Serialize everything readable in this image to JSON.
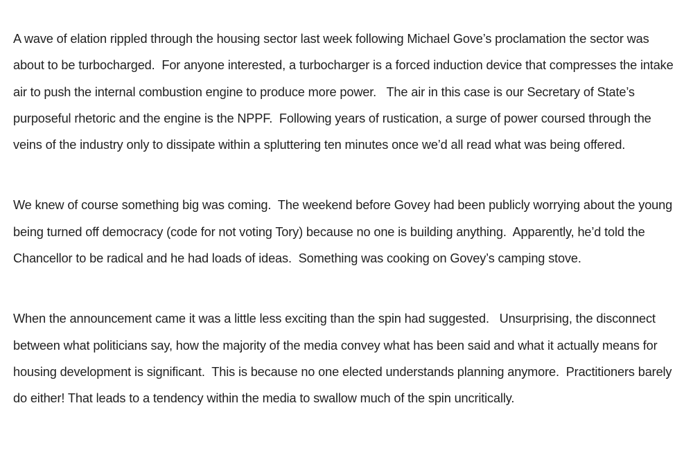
{
  "article": {
    "paragraphs": [
      "A wave of elation rippled through the housing sector last week following Michael Gove’s proclamation the sector was about to be turbocharged.  For anyone interested, a turbocharger is a forced induction device that compresses the intake air to push the internal combustion engine to produce more power.   The air in this case is our Secretary of State’s purposeful rhetoric and the engine is the NPPF.  Following years of rustication, a surge of power coursed through the veins of the industry only to dissipate within a spluttering ten minutes once we’d all read what was being offered.",
      "We knew of course something big was coming.  The weekend before Govey had been publicly worrying about the young being turned off democracy (code for not voting Tory) because no one is building anything.  Apparently, he’d told the Chancellor to be radical and he had loads of ideas.  Something was cooking on Govey’s camping stove.",
      "When the announcement came it was a little less exciting than the spin had suggested.   Unsurprising, the disconnect between what politicians say, how the majority of the media convey what has been said and what it actually means for housing development is significant.  This is because no one elected understands planning anymore.  Practitioners barely do either! That leads to a tendency within the media to swallow much of the spin uncritically."
    ]
  }
}
